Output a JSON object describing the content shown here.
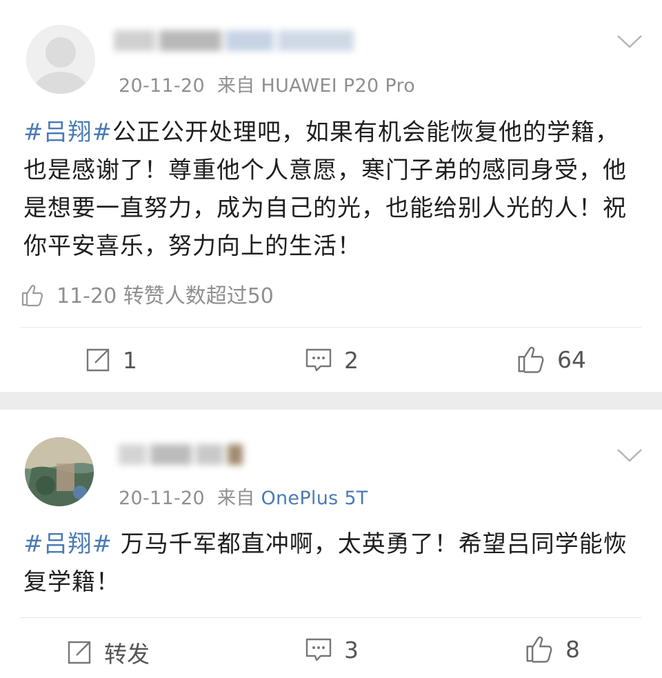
{
  "colors": {
    "link": "#4a7bb5",
    "meta": "#8f8f8f",
    "separator": "#ececec"
  },
  "posts": [
    {
      "time": "20-11-20",
      "source_prefix": "来自",
      "source": "HUAWEI P20 Pro",
      "hashtag": "#吕翔#",
      "text": "公正公开处理吧，如果有机会能恢复他的学籍，也是感谢了！尊重他个人意愿，寒门子弟的感同身受，他是想要一直努力，成为自己的光，也能给别人光的人！祝你平安喜乐，努力向上的生活！",
      "liked_by": "11-20 转赞人数超过50",
      "repost_label": "1",
      "comment_count": "2",
      "like_count": "64",
      "icons": {
        "repost": "share-icon",
        "comment": "comment-icon",
        "like": "thumbs-up-icon",
        "menu": "chevron-down-icon"
      }
    },
    {
      "time": "20-11-20",
      "source_prefix": "来自",
      "source": "OnePlus 5T",
      "hashtag": "#吕翔#",
      "text": " 万马千军都直冲啊，太英勇了！希望吕同学能恢复学籍！",
      "repost_label": "转发",
      "comment_count": "3",
      "like_count": "8",
      "icons": {
        "repost": "share-icon",
        "comment": "comment-icon",
        "like": "thumbs-up-icon",
        "menu": "chevron-down-icon"
      }
    }
  ]
}
